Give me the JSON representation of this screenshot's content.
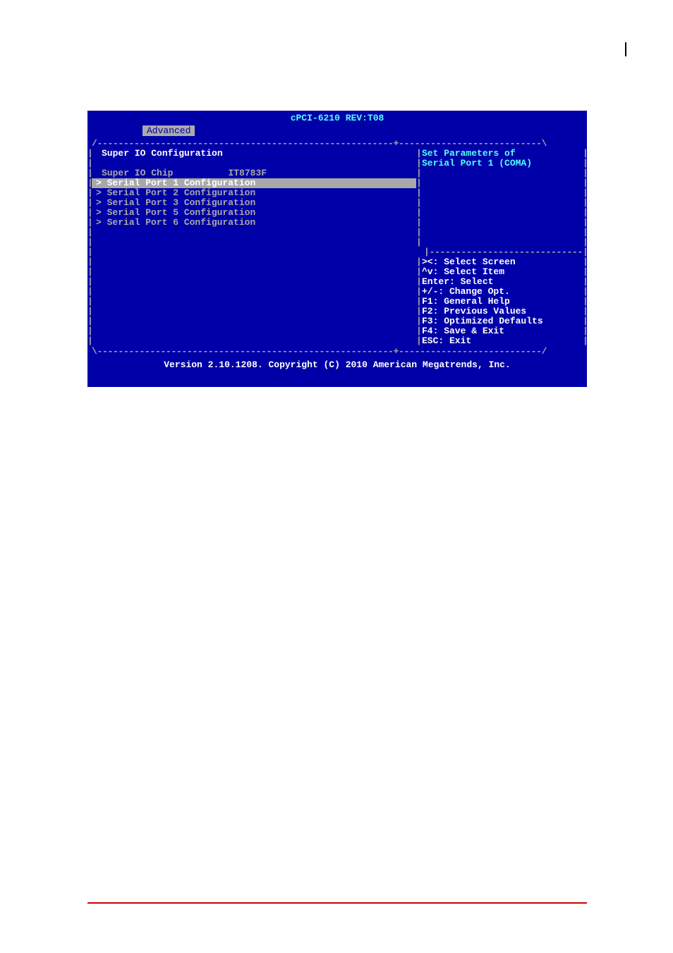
{
  "title": "cPCI-6210 REV:T08",
  "tab": "Advanced",
  "heading": "Super IO Configuration",
  "chip_label": "Super IO Chip",
  "chip_value": "IT8783F",
  "menu_items": [
    {
      "label": "Serial Port 1 Configuration",
      "selected": true
    },
    {
      "label": "Serial Port 2 Configuration",
      "selected": false
    },
    {
      "label": "Serial Port 3 Configuration",
      "selected": false
    },
    {
      "label": "Serial Port 5 Configuration",
      "selected": false
    },
    {
      "label": "Serial Port 6 Configuration",
      "selected": false
    }
  ],
  "help_line1": "Set Parameters of",
  "help_line2": "Serial Port 1 (COMA)",
  "keys": [
    "><: Select Screen",
    "^v: Select Item",
    "Enter: Select",
    "+/-: Change Opt.",
    "F1: General Help",
    "F2: Previous Values",
    "F3: Optimized Defaults",
    "F4: Save & Exit",
    "ESC: Exit"
  ],
  "footer": "Version 2.10.1208. Copyright (C) 2010 American Megatrends, Inc."
}
